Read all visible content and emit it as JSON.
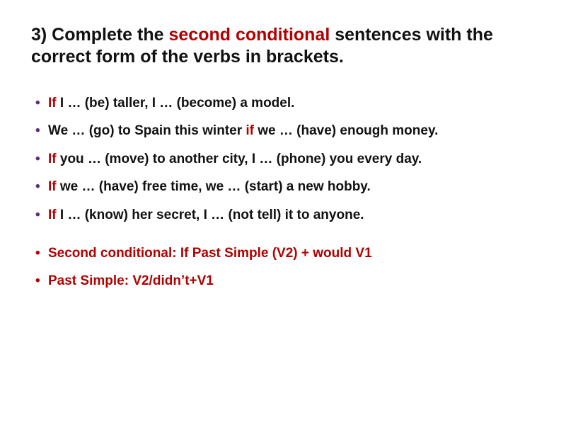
{
  "heading": {
    "part1": "3) Complete the ",
    "kw": "second conditional",
    "part2": " sentences with the correct form of the verbs in brackets."
  },
  "items": [
    {
      "if": "If",
      "rest": " I … (be) taller, I … (become) a model."
    },
    {
      "pre": "We … (go) to Spain this winter ",
      "if": "if",
      "rest": " we … (have) enough money."
    },
    {
      "if": "If",
      "rest": " you … (move) to another city, I … (phone) you every day."
    },
    {
      "if": "If",
      "rest": " we … (have) free time, we … (start) a new hobby."
    },
    {
      "if": "If",
      "rest": " I … (know) her secret, I … (not tell) it to anyone."
    }
  ],
  "rules": [
    {
      "label": "Second conditional: ",
      "if": "If",
      "rest": " Past Simple (V2) + would V1"
    },
    {
      "text": "Past Simple: V2/didn’t+V1"
    }
  ]
}
